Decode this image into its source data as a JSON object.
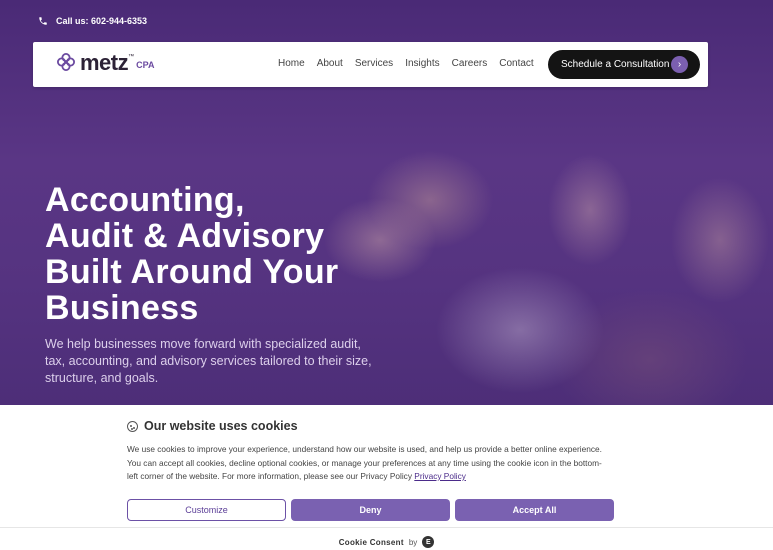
{
  "topbar": {
    "phone_text": "Call us: 602-944-6353"
  },
  "logo": {
    "name": "metz",
    "tm": "™",
    "suffix": "CPA",
    "brand_color": "#6b4aa0"
  },
  "nav": {
    "items": [
      {
        "label": "Home"
      },
      {
        "label": "About"
      },
      {
        "label": "Services"
      },
      {
        "label": "Insights"
      },
      {
        "label": "Careers"
      },
      {
        "label": "Contact"
      }
    ],
    "cta_label": "Schedule a Consultation",
    "cta_arrow": "›"
  },
  "hero": {
    "headline_lines": [
      "Accounting,",
      "Audit & Advisory",
      "Built Around Your",
      "Business"
    ],
    "subtext": "We help businesses move forward with specialized audit, tax, accounting, and advisory services tailored to their size, structure, and goals."
  },
  "cookie": {
    "title": "Our website uses cookies",
    "body": "We use cookies to improve your experience, understand how our website is used, and help us provide a better online experience. You can accept all cookies, decline optional cookies, or manage your preferences at any time using the cookie icon in the bottom-left corner of the website. For more information, please see our Privacy Policy",
    "privacy_link": "Privacy Policy",
    "customize_label": "Customize",
    "deny_label": "Deny",
    "accept_label": "Accept All",
    "footer_brand": "Cookie Consent",
    "footer_by": "by"
  },
  "colors": {
    "hero_purple": "#4a2a76",
    "accent": "#7a61b1",
    "cta_bg": "#141414"
  }
}
